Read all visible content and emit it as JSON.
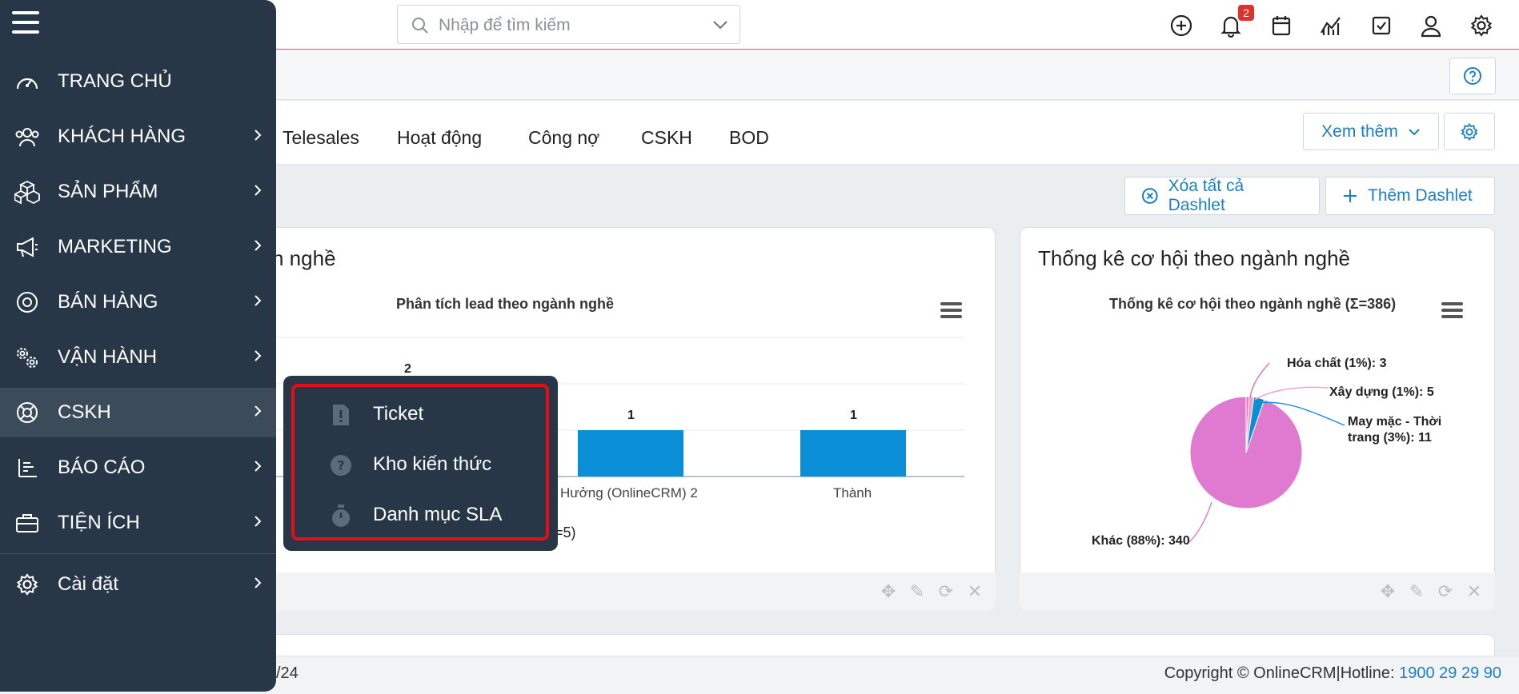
{
  "header": {
    "search_placeholder": "Nhập để tìm kiếm",
    "notification_count": "2",
    "icons": [
      "plus-circle-icon",
      "bell-icon",
      "calendar-icon",
      "chart-icon",
      "checkbox-icon",
      "user-icon",
      "gear-icon"
    ]
  },
  "tabs": [
    "Telesales",
    "Hoạt động",
    "Công nợ",
    "CSKH",
    "BOD"
  ],
  "toolbar": {
    "more_label": "Xem thêm",
    "delete_all_label": "Xóa tất cả Dashlet",
    "add_label": "Thêm Dashlet"
  },
  "dashlet_left": {
    "title_fragment": "h nghề",
    "chart_title": "Phân tích lead theo ngành nghề",
    "total_fragment": "=5)"
  },
  "dashlet_right": {
    "title": "Thống kê cơ hội theo ngành nghề",
    "chart_title": "Thống kê cơ hội theo ngành nghề (Σ=386)"
  },
  "chart_data": [
    {
      "type": "bar",
      "title": "Phân tích lead theo ngành nghề",
      "categories": [
        "Hưởng (OnlineCRM) 2",
        "Thành"
      ],
      "values": [
        1,
        1
      ],
      "extra_label_visible": "2",
      "ylim": [
        0,
        3
      ],
      "grid": true,
      "color": "#0a8fd6"
    },
    {
      "type": "pie",
      "title": "Thống kê cơ hội theo ngành nghề (Σ=386)",
      "slices": [
        {
          "label": "Khác (88%): 340",
          "value": 340,
          "color": "#e07ad0"
        },
        {
          "label": "May mặc - Thời trang (3%): 11",
          "value": 11,
          "color": "#0a8fd6"
        },
        {
          "label": "Xây dựng (1%): 5",
          "value": 5,
          "color": "#f2a0c8"
        },
        {
          "label": "Hóa chất (1%): 3",
          "value": 3,
          "color": "#f06ab4"
        }
      ],
      "labels_display": {
        "hoa_chat": "Hóa chất (1%): 3",
        "xay_dung": "Xây dựng (1%): 5",
        "may_mac_1": "May mặc - Thời",
        "may_mac_2": "trang (3%): 11",
        "khac": "Khác (88%): 340"
      }
    }
  ],
  "sidebar": {
    "items": [
      {
        "label": "TRANG CHỦ",
        "icon": "dashboard-icon"
      },
      {
        "label": "KHÁCH HÀNG",
        "icon": "users-icon"
      },
      {
        "label": "SẢN PHẨM",
        "icon": "boxes-icon"
      },
      {
        "label": "MARKETING",
        "icon": "megaphone-icon"
      },
      {
        "label": "BÁN HÀNG",
        "icon": "target-icon"
      },
      {
        "label": "VẬN HÀNH",
        "icon": "cogs-icon"
      },
      {
        "label": "CSKH",
        "icon": "lifebuoy-icon"
      },
      {
        "label": "BÁO CÁO",
        "icon": "report-icon"
      },
      {
        "label": "TIỆN ÍCH",
        "icon": "briefcase-icon"
      },
      {
        "label": "Cài đặt",
        "icon": "settings-icon"
      }
    ],
    "active": "CSKH"
  },
  "flyout": {
    "items": [
      {
        "label": "Ticket",
        "icon": "ticket-alert-icon"
      },
      {
        "label": "Kho kiến thức",
        "icon": "question-icon"
      },
      {
        "label": "Danh mục SLA",
        "icon": "stopwatch-icon"
      }
    ]
  },
  "footer": {
    "page_fragment": "/24",
    "copyright": "Copyright © OnlineCRM",
    "separator": "|",
    "hotline_label": "Hotline: ",
    "hotline_number": "1900 29 29 90"
  }
}
